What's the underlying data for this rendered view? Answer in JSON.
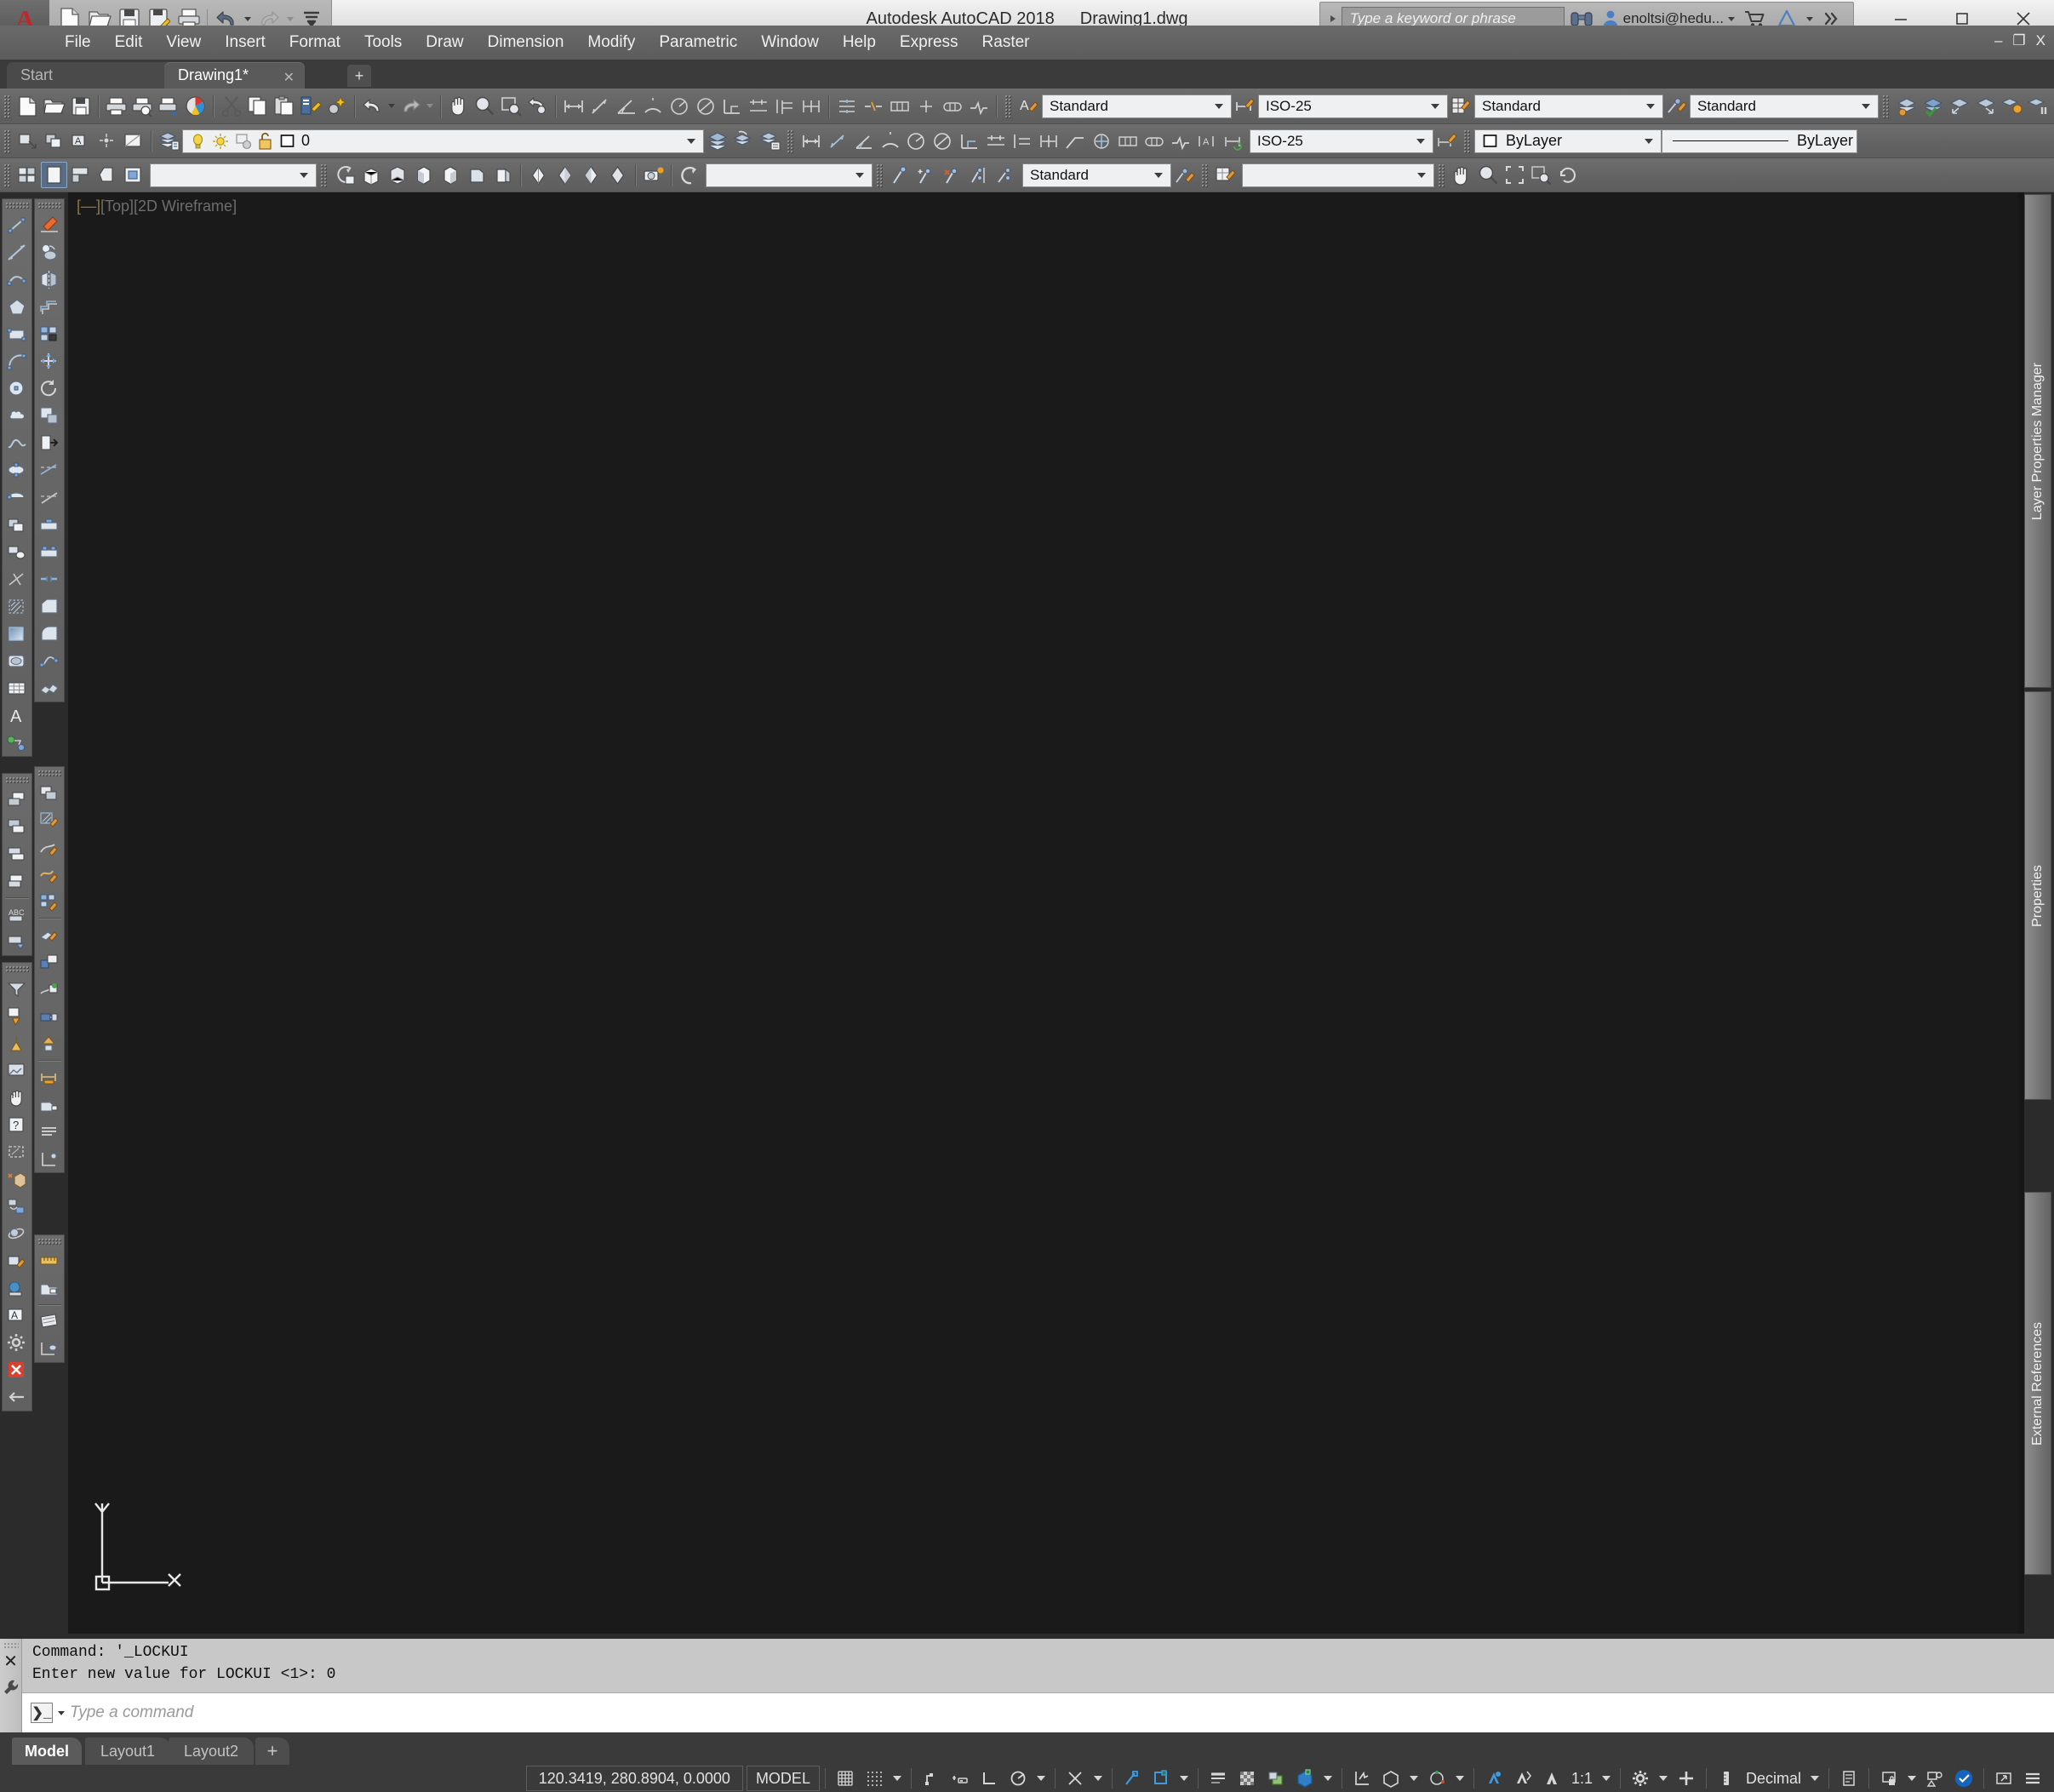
{
  "window": {
    "app_title": "Autodesk AutoCAD 2018",
    "document_title": "Drawing1.dwg",
    "minimize": "─",
    "maximize": "☐",
    "close": "✕",
    "inner_minimize": "–",
    "inner_restore": "❐",
    "inner_close": "X"
  },
  "quick_access": {
    "items": [
      {
        "name": "new-file-icon",
        "label": "New"
      },
      {
        "name": "open-file-icon",
        "label": "Open"
      },
      {
        "name": "save-icon",
        "label": "Save"
      },
      {
        "name": "save-as-icon",
        "label": "Save As"
      },
      {
        "name": "plot-icon",
        "label": "Plot"
      },
      {
        "name": "undo-icon",
        "label": "Undo"
      },
      {
        "name": "redo-icon",
        "label": "Redo"
      },
      {
        "name": "customize-icon",
        "label": "Customize Quick Access Toolbar"
      }
    ]
  },
  "infocenter": {
    "search_placeholder": "Type a keyword or phrase",
    "account_name": "enoltsi@hedu...",
    "icons": [
      "binoculars-icon",
      "user-icon",
      "cart-icon",
      "autodesk-360-icon",
      "chevron-right-icon"
    ]
  },
  "menu": {
    "items": [
      "File",
      "Edit",
      "View",
      "Insert",
      "Format",
      "Tools",
      "Draw",
      "Dimension",
      "Modify",
      "Parametric",
      "Window",
      "Help",
      "Express",
      "Raster"
    ]
  },
  "file_tabs": {
    "tabs": [
      {
        "label": "Start",
        "active": false,
        "closable": false
      },
      {
        "label": "Drawing1*",
        "active": true,
        "closable": true
      }
    ],
    "close_glyph": "✕",
    "new_tab_glyph": "+"
  },
  "toolbars": {
    "row1": {
      "text_style": {
        "label": "Standard",
        "icon": "text-style-icon"
      },
      "dim_style": {
        "label": "ISO-25",
        "icon": "dimension-style-icon"
      },
      "table_style": {
        "label": "Standard",
        "icon": "table-style-icon"
      },
      "mleader_style": {
        "label": "Standard",
        "icon": "multileader-style-icon"
      }
    },
    "row2": {
      "layer_value": "0",
      "layer_icons": [
        "lightbulb-on-icon",
        "sun-freeze-icon",
        "viewport-freeze-icon",
        "unlock-icon",
        "layer-color-swatch-icon"
      ],
      "dim_style2": {
        "label": "ISO-25"
      },
      "color_control": {
        "label": "ByLayer",
        "swatch": "#ffffff"
      },
      "linetype_control": {
        "label": "ByLayer"
      }
    },
    "row3": {
      "ucs_combo_value": "",
      "view_combo_value": "",
      "dim_standard": {
        "label": "Standard"
      },
      "right_combo_value": ""
    }
  },
  "viewport": {
    "label_view": "[Top]",
    "label_visual_style": "[2D Wireframe]",
    "label_dash": "[—]",
    "ucs": {
      "x_label": "X",
      "y_label": "Y"
    },
    "background": "#1a1a1a"
  },
  "right_dock": {
    "panels": [
      {
        "label": "Layer Properties Manager"
      },
      {
        "label": "Properties"
      },
      {
        "label": "External References"
      }
    ]
  },
  "command_line": {
    "history": [
      "Command: '_LOCKUI",
      "Enter new value for LOCKUI <1>: 0"
    ],
    "placeholder": "Type a command",
    "prompt_glyph": "❯_",
    "close_glyph": "✕",
    "settings_glyph": "wrench-icon"
  },
  "status_bar": {
    "layout_tabs": [
      {
        "label": "Model",
        "active": true
      },
      {
        "label": "Layout1",
        "active": false
      },
      {
        "label": "Layout2",
        "active": false
      }
    ],
    "add_layout_glyph": "+",
    "coordinates": "120.3419, 280.8904, 0.0000",
    "space_label": "MODEL",
    "annotation_scale": "1:1",
    "units": "Decimal",
    "toggles": [
      {
        "name": "grid-display-icon",
        "active": false
      },
      {
        "name": "snap-mode-icon",
        "active": false
      },
      {
        "name": "infer-constraints-icon",
        "active": false
      },
      {
        "name": "dynamic-input-icon",
        "active": false
      },
      {
        "name": "ortho-mode-icon",
        "active": false
      },
      {
        "name": "polar-tracking-icon",
        "active": false
      },
      {
        "name": "isometric-drafting-icon",
        "active": false
      },
      {
        "name": "object-snap-tracking-icon",
        "active": true
      },
      {
        "name": "object-snap-icon",
        "active": true
      },
      {
        "name": "lineweight-icon",
        "active": false
      },
      {
        "name": "transparency-icon",
        "active": false
      },
      {
        "name": "selection-cycling-icon",
        "active": false
      },
      {
        "name": "3d-object-snap-icon",
        "active": true
      },
      {
        "name": "dynamic-ucs-icon",
        "active": false
      },
      {
        "name": "selection-filter-icon",
        "active": false
      },
      {
        "name": "gizmo-icon",
        "active": false
      },
      {
        "name": "annotation-visibility-icon",
        "active": true
      },
      {
        "name": "autoscale-icon",
        "active": true
      },
      {
        "name": "annotation-scale-icon",
        "active": true
      },
      {
        "name": "workspace-switching-icon",
        "active": false
      },
      {
        "name": "annotation-monitor-icon",
        "active": false
      },
      {
        "name": "units-icon",
        "active": false
      },
      {
        "name": "quick-properties-icon",
        "active": false
      },
      {
        "name": "lock-ui-icon",
        "active": false
      },
      {
        "name": "isolate-objects-icon",
        "active": false
      },
      {
        "name": "graphics-performance-icon",
        "active": true
      },
      {
        "name": "clean-screen-icon",
        "active": false
      },
      {
        "name": "customization-icon",
        "active": false
      }
    ]
  },
  "colors": {
    "canvas_bg": "#1a1a1a",
    "toolbar_bg": "#656565",
    "statusbar_bg": "#3a3a3a",
    "accent_blue": "#2f8ed6",
    "titlebar_bg": "#e8e8e8",
    "command_bg": "#c8c8c8"
  }
}
